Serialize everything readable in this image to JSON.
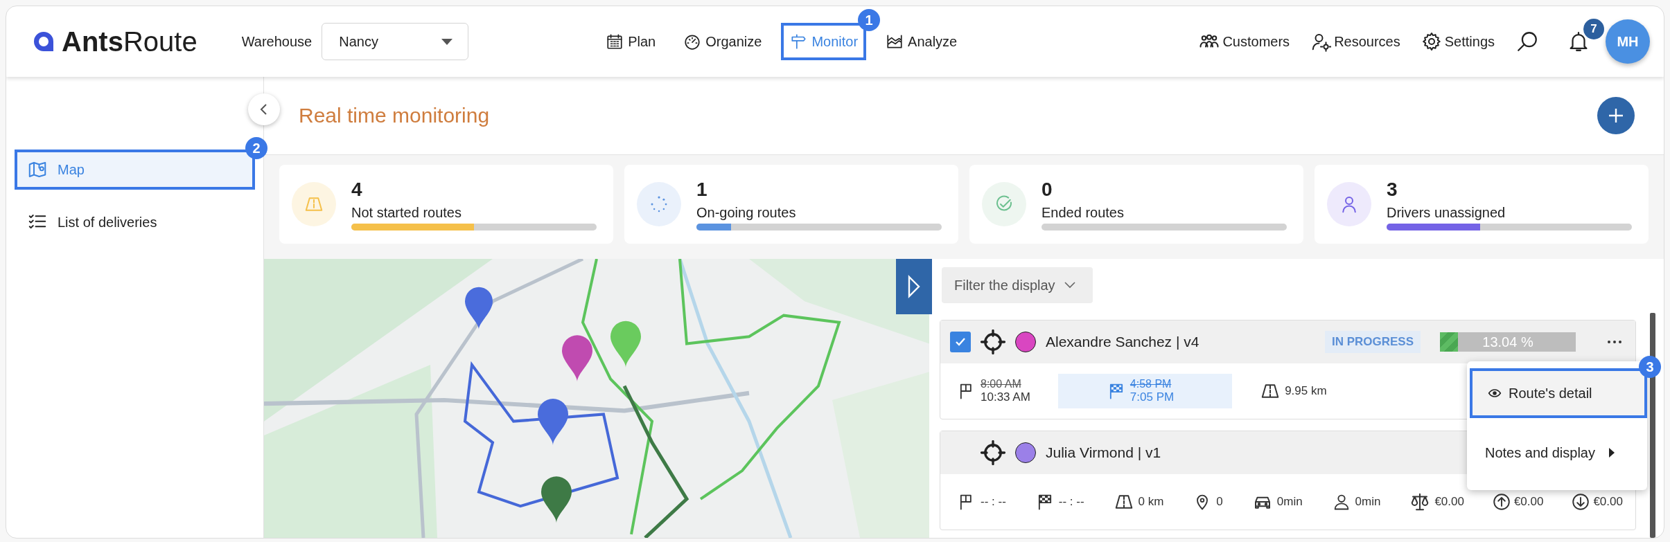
{
  "logo": {
    "bold": "Ants",
    "light": "Route"
  },
  "warehouse": {
    "label": "Warehouse",
    "value": "Nancy"
  },
  "nav": [
    {
      "label": "Plan",
      "selected": false
    },
    {
      "label": "Organize",
      "selected": false
    },
    {
      "label": "Monitor",
      "selected": true,
      "callout": "1"
    },
    {
      "label": "Analyze",
      "selected": false
    }
  ],
  "tools": [
    {
      "label": "Customers"
    },
    {
      "label": "Resources"
    },
    {
      "label": "Settings"
    }
  ],
  "notifications": {
    "count": "7"
  },
  "avatar": {
    "initials": "MH"
  },
  "sidebar": {
    "items": [
      {
        "label": "Map",
        "selected": true,
        "callout": "2"
      },
      {
        "label": "List of deliveries",
        "selected": false
      }
    ]
  },
  "page_title": "Real time monitoring",
  "kpis": [
    {
      "value": "4",
      "label": "Not started routes",
      "level": 0.5,
      "color": "#f5c04a"
    },
    {
      "value": "1",
      "label": "On-going routes",
      "level": 0.14,
      "color": "#5b93e0"
    },
    {
      "value": "0",
      "label": "Ended routes",
      "level": 0,
      "color": "#6cc08f"
    },
    {
      "value": "3",
      "label": "Drivers unassigned",
      "level": 0.38,
      "color": "#7463e6"
    }
  ],
  "filter": {
    "label": "Filter the display"
  },
  "routes": [
    {
      "driver": "Alexandre Sanchez | v4",
      "color": "#d946c1",
      "checked": true,
      "status": "IN PROGRESS",
      "level": 0.1304,
      "progress": "13.04 %",
      "metrics": [
        {
          "kind": "start",
          "planned": "8:00 AM",
          "value": "10:33 AM",
          "highlighted": false
        },
        {
          "kind": "end",
          "planned": "4:58 PM",
          "value": "7:05 PM",
          "highlighted": true
        },
        {
          "kind": "distance",
          "value": "9.95 km",
          "highlighted": false
        }
      ]
    },
    {
      "driver": "Julia Virmond | v1",
      "color": "#9b80e8",
      "checked": false,
      "metrics": [
        {
          "kind": "start",
          "value": "-- : --",
          "highlighted": false
        },
        {
          "kind": "end",
          "value": "-- : --",
          "highlighted": false
        },
        {
          "kind": "distance",
          "value": "0 km",
          "highlighted": false
        },
        {
          "kind": "stops",
          "value": "0",
          "highlighted": false
        },
        {
          "kind": "drive",
          "value": "0min",
          "highlighted": false
        },
        {
          "kind": "work",
          "value": "0min",
          "highlighted": false
        },
        {
          "kind": "cost",
          "value": "€0.00",
          "highlighted": false
        },
        {
          "kind": "income",
          "value": "€0.00",
          "highlighted": false
        },
        {
          "kind": "expense",
          "value": "€0.00",
          "highlighted": false
        }
      ]
    }
  ],
  "context_menu": {
    "items": [
      {
        "label": "Route's detail",
        "selected": true,
        "submenu": false,
        "callout": "3"
      },
      {
        "label": "Notes and display",
        "selected": false,
        "submenu": true
      }
    ]
  }
}
